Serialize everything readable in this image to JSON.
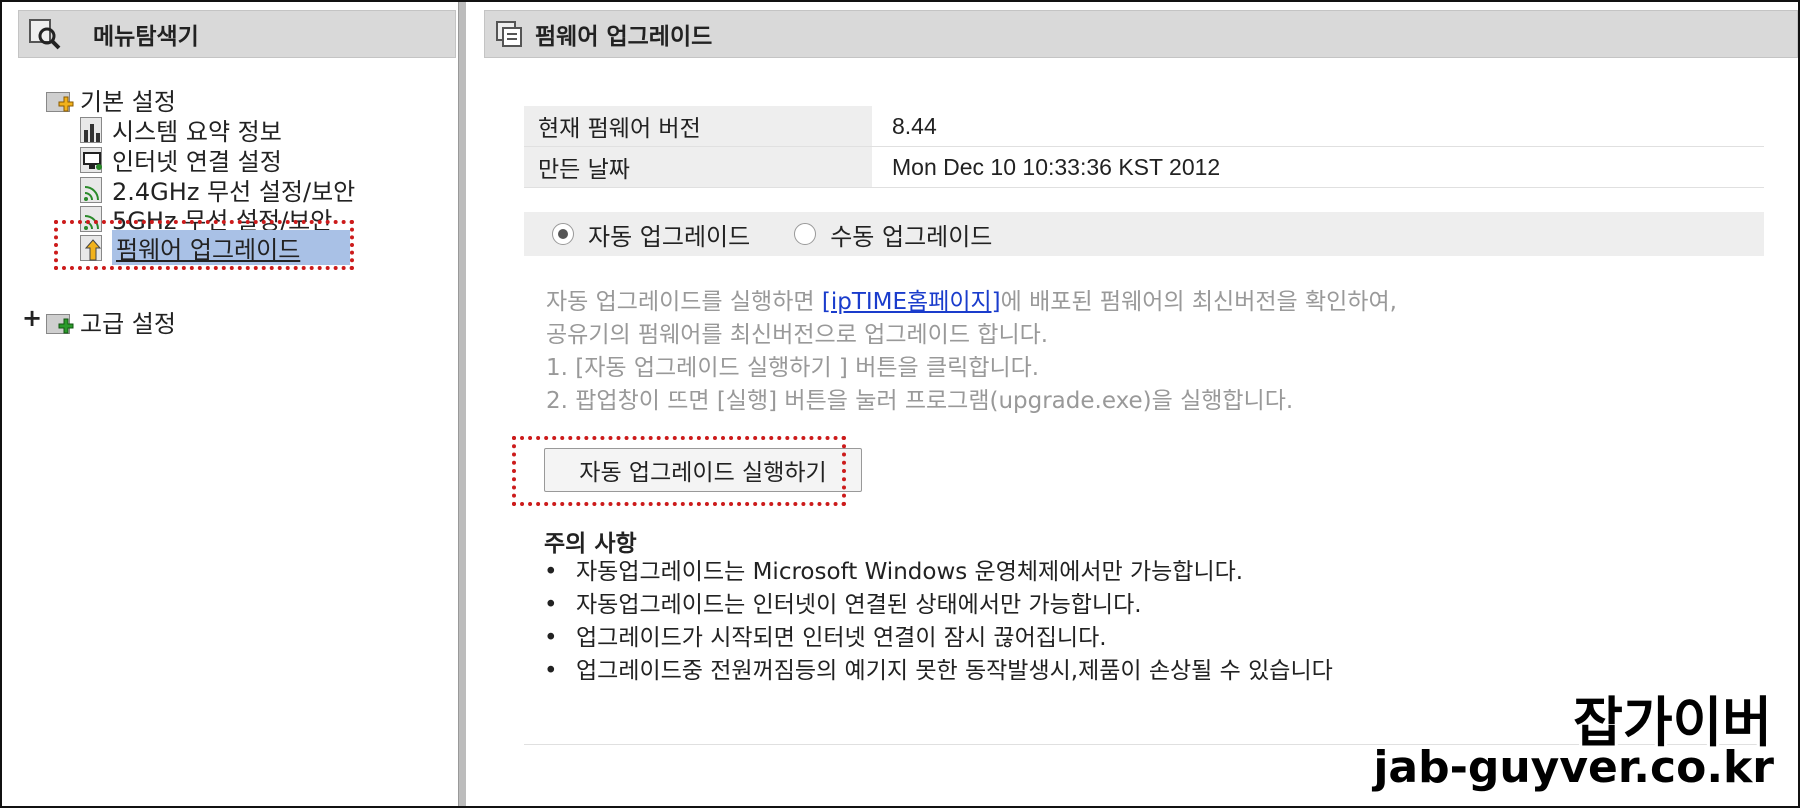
{
  "sidebar": {
    "title": "메뉴탐색기",
    "tree": [
      {
        "label": "기본 설정",
        "icon": "folder-icon"
      },
      {
        "label": "시스템 요약 정보",
        "icon": "chart-icon"
      },
      {
        "label": "인터넷 연결 설정",
        "icon": "monitor-icon"
      },
      {
        "label": "2.4GHz 무선 설정/보안",
        "icon": "wifi-icon"
      },
      {
        "label": "5GHz 무선 설정/보안",
        "icon": "wifi-icon"
      },
      {
        "label": "펌웨어 업그레이드",
        "icon": "upgrade-icon",
        "selected": true
      },
      {
        "label": "고급 설정",
        "icon": "folder-icon",
        "expander": "+"
      }
    ]
  },
  "main": {
    "title": "펌웨어 업그레이드",
    "info": [
      {
        "label": "현재 펌웨어 버전",
        "value": "8.44"
      },
      {
        "label": "만든 날짜",
        "value": "Mon Dec 10 10:33:36 KST 2012"
      }
    ],
    "radios": [
      {
        "label": "자동 업그레이드",
        "checked": true
      },
      {
        "label": "수동 업그레이드",
        "checked": false
      }
    ],
    "description": {
      "line1_pre": "자동 업그레이드를 실행하면 ",
      "link": "[ipTIME홈페이지]",
      "line1_post": "에 배포된 펌웨어의 최신버전을 확인하여,",
      "line2": "공유기의 펌웨어를 최신버전으로 업그레이드 합니다.",
      "line3": "1. [자동 업그레이드 실행하기 ] 버튼을 클릭합니다.",
      "line4": "2. 팝업창이 뜨면 [실행] 버튼을 눌러 프로그램(upgrade.exe)을 실행합니다."
    },
    "run_button": "자동 업그레이드 실행하기",
    "notice_title": "주의 사항",
    "notices": [
      "자동업그레이드는 Microsoft Windows 운영체제에서만 가능합니다.",
      "자동업그레이드는 인터넷이 연결된 상태에서만 가능합니다.",
      "업그레이드가 시작되면 인터넷 연결이 잠시 끊어집니다.",
      "업그레이드중 전원꺼짐등의 예기지 못한 동작발생시,제품이 손상될 수 있습니다"
    ]
  },
  "watermark": {
    "name": "잡가이버",
    "url": "jab-guyver.co.kr"
  },
  "colors": {
    "highlight": "#cc1b1b",
    "selected_bg": "#a9c1e6",
    "link": "#1a3ccc"
  }
}
